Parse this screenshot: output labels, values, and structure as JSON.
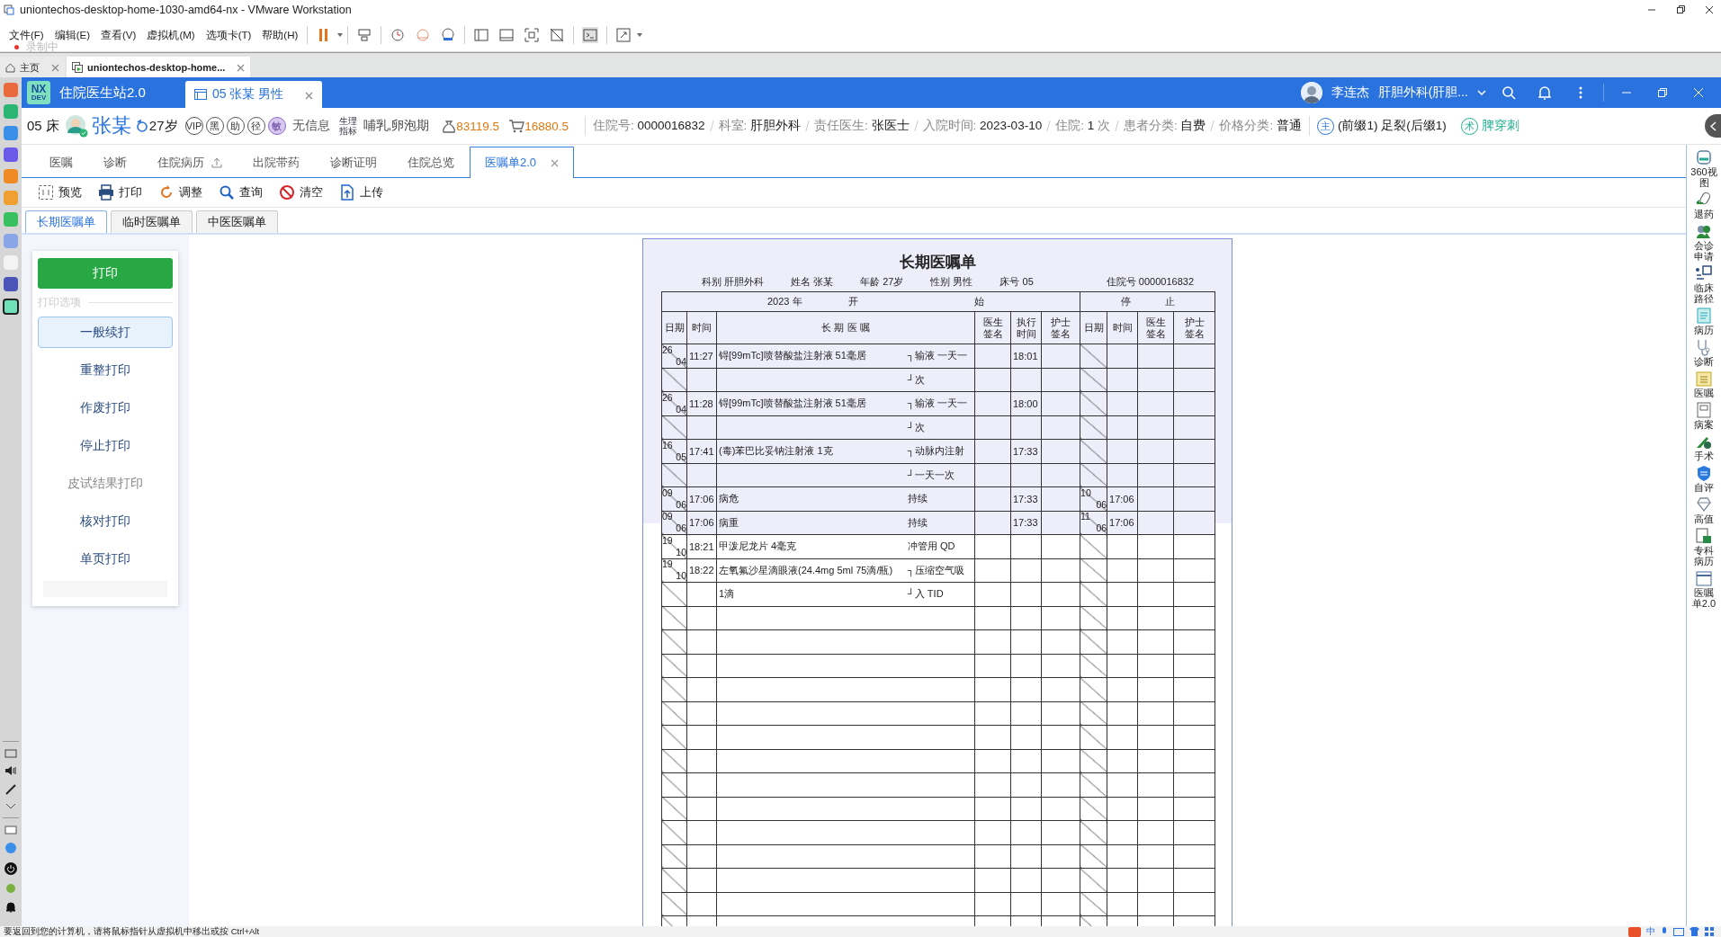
{
  "vm_window": {
    "title": "uniontechos-desktop-home-1030-amd64-nx - VMware Workstation",
    "menu": [
      "文件(F)",
      "编辑(E)",
      "查看(V)",
      "虚拟机(M)",
      "选项卡(T)",
      "帮助(H)"
    ],
    "recording_label": "录制中",
    "tabs": [
      {
        "label": "主页",
        "kind": "home",
        "selected": false
      },
      {
        "label": "uniontechos-desktop-home...",
        "kind": "vm",
        "selected": true
      }
    ]
  },
  "app": {
    "logo_top": "NX",
    "logo_bottom": "DEV",
    "title": "住院医生站2.0",
    "patient_tab": "05 张某 男性",
    "user_name": "李连杰",
    "department": "肝胆外科(肝胆..."
  },
  "patient": {
    "bed": "05 床",
    "name": "张某",
    "age": "27岁",
    "badges": [
      {
        "text": "VIP",
        "kind": "outline"
      },
      {
        "text": "黑",
        "kind": "outline"
      },
      {
        "text": "助",
        "kind": "outline"
      },
      {
        "text": "径",
        "kind": "outline"
      },
      {
        "text": "敏",
        "kind": "allergy"
      }
    ],
    "allergy_info": "无信息",
    "physio_label": "生理指标",
    "physio_value": "哺乳,卵泡期",
    "balance": "83119.5",
    "cost": "16880.5",
    "fields": [
      {
        "label": "住院号:",
        "value": "0000016832"
      },
      {
        "label": "科室:",
        "value": "肝胆外科"
      },
      {
        "label": "责任医生:",
        "value": "张医士"
      },
      {
        "label": "入院时间:",
        "value": "2023-03-10"
      },
      {
        "label": "住院:",
        "value": "1",
        "unit": "次"
      },
      {
        "label": "患者分类:",
        "value": "自费"
      },
      {
        "label": "价格分类:",
        "value": "普通"
      }
    ],
    "diagnosis_tag": "主",
    "diagnosis": "(前缀1) 足裂(后缀1)",
    "surgery_tag": "术",
    "surgery": "脾穿刺"
  },
  "tabs": [
    {
      "label": "医嘱",
      "selected": false,
      "upload": false
    },
    {
      "label": "诊断",
      "selected": false,
      "upload": false
    },
    {
      "label": "住院病历",
      "selected": false,
      "upload": true
    },
    {
      "label": "出院带药",
      "selected": false,
      "upload": false
    },
    {
      "label": "诊断证明",
      "selected": false,
      "upload": false
    },
    {
      "label": "住院总览",
      "selected": false,
      "upload": false
    },
    {
      "label": "医嘱单2.0",
      "selected": true,
      "upload": false
    }
  ],
  "toolbar": [
    {
      "label": "预览",
      "kind": "preview"
    },
    {
      "label": "打印",
      "kind": "print"
    },
    {
      "label": "调整",
      "kind": "adjust"
    },
    {
      "label": "查询",
      "kind": "search"
    },
    {
      "label": "清空",
      "kind": "clear"
    },
    {
      "label": "上传",
      "kind": "upload"
    }
  ],
  "sheet_tabs": [
    {
      "label": "长期医嘱单",
      "selected": true
    },
    {
      "label": "临时医嘱单",
      "selected": false
    },
    {
      "label": "中医医嘱单",
      "selected": false
    }
  ],
  "print_panel": {
    "print_button": "打印",
    "options_caption": "打印选项",
    "options": [
      {
        "label": "一般续打",
        "selected": true,
        "disabled": false
      },
      {
        "label": "重整打印",
        "selected": false,
        "disabled": false
      },
      {
        "label": "作废打印",
        "selected": false,
        "disabled": false
      },
      {
        "label": "停止打印",
        "selected": false,
        "disabled": false
      },
      {
        "label": "皮试结果打印",
        "selected": false,
        "disabled": true
      },
      {
        "label": "核对打印",
        "selected": false,
        "disabled": false
      },
      {
        "label": "单页打印",
        "selected": false,
        "disabled": false
      }
    ]
  },
  "order_sheet": {
    "title": "长期医嘱单",
    "info": [
      {
        "label": "科别",
        "value": "肝胆外科"
      },
      {
        "label": "姓名",
        "value": "张某"
      },
      {
        "label": "年龄",
        "value": "27岁"
      },
      {
        "label": "性别",
        "value": "男性"
      },
      {
        "label": "床号",
        "value": "05"
      },
      {
        "label": "住院号",
        "value": "0000016832"
      }
    ],
    "year": "2023 年",
    "start_label": [
      "开",
      "始"
    ],
    "stop_label": [
      "停",
      "止"
    ],
    "columns": [
      "日期",
      "时间",
      "长 期 医 嘱",
      "医生签名",
      "执行时间",
      "护士签名",
      "日期",
      "时间",
      "医生签名",
      "护士签名"
    ],
    "rows": [
      {
        "kind": "order",
        "highlighted": true,
        "day": "26",
        "month": "04",
        "time": "11:27",
        "order": "锝[99mTc]喷替酸盐注射液 51毫居",
        "route": "┐输液 一天一",
        "exec_time": "18:01"
      },
      {
        "kind": "order",
        "highlighted": true,
        "route": "┘次"
      },
      {
        "kind": "order",
        "highlighted": true,
        "day": "26",
        "month": "04",
        "time": "11:28",
        "order": "锝[99mTc]喷替酸盐注射液 51毫居",
        "route": "┐输液 一天一",
        "exec_time": "18:00"
      },
      {
        "kind": "order",
        "highlighted": true,
        "route": "┘次"
      },
      {
        "kind": "order",
        "highlighted": true,
        "day": "16",
        "month": "05",
        "time": "17:41",
        "order": "(毒)苯巴比妥钠注射液 1克",
        "route": "┐动脉内注射",
        "exec_time": "17:33"
      },
      {
        "kind": "order",
        "highlighted": true,
        "route": "┘一天一次"
      },
      {
        "kind": "order",
        "highlighted": true,
        "day": "09",
        "month": "06",
        "time": "17:06",
        "order": "病危",
        "route": "持续",
        "exec_time": "17:33",
        "stop_day": "10",
        "stop_month": "06",
        "stop_time": "17:06"
      },
      {
        "kind": "order",
        "highlighted": true,
        "day": "09",
        "month": "06",
        "time": "17:06",
        "order": "病重",
        "route": "持续",
        "exec_time": "17:33",
        "stop_day": "11",
        "stop_month": "06",
        "stop_time": "17:06"
      },
      {
        "kind": "order",
        "highlighted": false,
        "day": "19",
        "month": "10",
        "time": "18:21",
        "order": "甲泼尼龙片 4毫克",
        "route": "冲管用 QD"
      },
      {
        "kind": "order",
        "highlighted": false,
        "day": "19",
        "month": "10",
        "time": "18:22",
        "order": "左氧氟沙星滴眼液(24.4mg 5ml 75滴/瓶)",
        "route": "┐压缩空气吸"
      },
      {
        "kind": "order",
        "highlighted": false,
        "order": "1滴",
        "route": "┘入 TID"
      },
      {
        "kind": "blank",
        "highlighted": false
      },
      {
        "kind": "blank",
        "highlighted": false
      },
      {
        "kind": "blank",
        "highlighted": false
      },
      {
        "kind": "blank",
        "highlighted": false
      },
      {
        "kind": "blank",
        "highlighted": false
      },
      {
        "kind": "blank",
        "highlighted": false
      },
      {
        "kind": "blank",
        "highlighted": false
      },
      {
        "kind": "blank",
        "highlighted": false
      },
      {
        "kind": "blank",
        "highlighted": false
      },
      {
        "kind": "blank",
        "highlighted": false
      },
      {
        "kind": "blank",
        "highlighted": false
      },
      {
        "kind": "blank",
        "highlighted": false
      },
      {
        "kind": "blank",
        "highlighted": false
      },
      {
        "kind": "blank",
        "highlighted": false
      }
    ]
  },
  "right_rail": [
    {
      "label": "360视图",
      "kind": "view360"
    },
    {
      "label": "退药",
      "kind": "return"
    },
    {
      "label": "会诊申请",
      "kind": "consult"
    },
    {
      "label": "临床路径",
      "kind": "path"
    },
    {
      "label": "病历",
      "kind": "record"
    },
    {
      "label": "诊断",
      "kind": "diagnosis"
    },
    {
      "label": "医嘱",
      "kind": "orders"
    },
    {
      "label": "病案",
      "kind": "case"
    },
    {
      "label": "手术",
      "kind": "surgery"
    },
    {
      "label": "自评",
      "kind": "shield"
    },
    {
      "label": "高值",
      "kind": "diamond"
    },
    {
      "label": "专科病历",
      "kind": "special"
    },
    {
      "label": "医嘱单2.0",
      "kind": "sheet"
    }
  ],
  "status_bar": "要返回到您的计算机，请将鼠标指针从虚拟机中移出或按 Ctrl+Alt",
  "ime_label": "中"
}
